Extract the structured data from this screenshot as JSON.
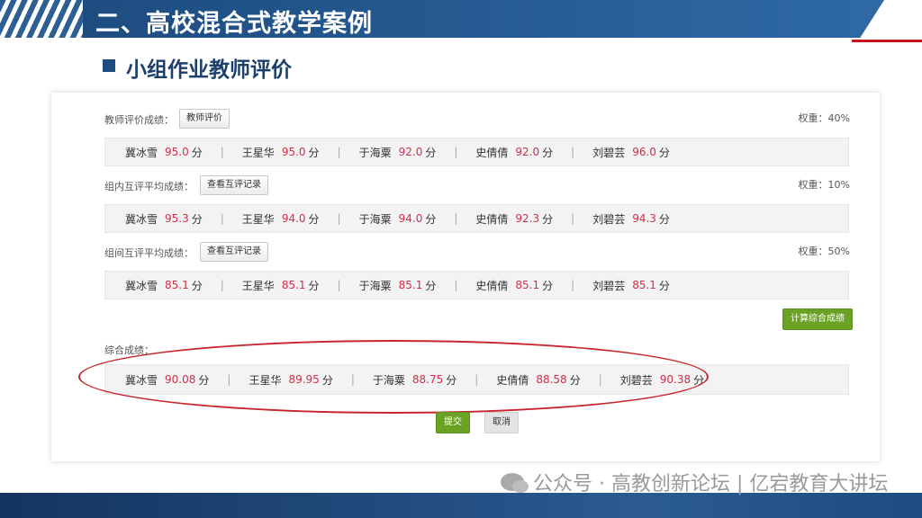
{
  "header": {
    "title": "二、高校混合式教学案例"
  },
  "subheader": {
    "title": "小组作业教师评价"
  },
  "sections": [
    {
      "label": "教师评价成绩：",
      "button": "教师评价",
      "weight": "权重：40%",
      "scores": [
        {
          "name": "冀冰雪",
          "value": "95.0",
          "unit": "分"
        },
        {
          "name": "王星华",
          "value": "95.0",
          "unit": "分"
        },
        {
          "name": "于海粟",
          "value": "92.0",
          "unit": "分"
        },
        {
          "name": "史倩倩",
          "value": "92.0",
          "unit": "分"
        },
        {
          "name": "刘碧芸",
          "value": "96.0",
          "unit": "分"
        }
      ]
    },
    {
      "label": "组内互评平均成绩：",
      "button": "查看互评记录",
      "weight": "权重：10%",
      "scores": [
        {
          "name": "冀冰雪",
          "value": "95.3",
          "unit": "分"
        },
        {
          "name": "王星华",
          "value": "94.0",
          "unit": "分"
        },
        {
          "name": "于海粟",
          "value": "94.0",
          "unit": "分"
        },
        {
          "name": "史倩倩",
          "value": "92.3",
          "unit": "分"
        },
        {
          "name": "刘碧芸",
          "value": "94.3",
          "unit": "分"
        }
      ]
    },
    {
      "label": "组间互评平均成绩：",
      "button": "查看互评记录",
      "weight": "权重：50%",
      "scores": [
        {
          "name": "冀冰雪",
          "value": "85.1",
          "unit": "分"
        },
        {
          "name": "王星华",
          "value": "85.1",
          "unit": "分"
        },
        {
          "name": "于海粟",
          "value": "85.1",
          "unit": "分"
        },
        {
          "name": "史倩倩",
          "value": "85.1",
          "unit": "分"
        },
        {
          "name": "刘碧芸",
          "value": "85.1",
          "unit": "分"
        }
      ]
    }
  ],
  "calc_button": "计算综合成绩",
  "total": {
    "label": "综合成绩：",
    "scores": [
      {
        "name": "冀冰雪",
        "value": "90.08",
        "unit": "分"
      },
      {
        "name": "王星华",
        "value": "89.95",
        "unit": "分"
      },
      {
        "name": "于海粟",
        "value": "88.75",
        "unit": "分"
      },
      {
        "name": "史倩倩",
        "value": "88.58",
        "unit": "分"
      },
      {
        "name": "刘碧芸",
        "value": "90.38",
        "unit": "分"
      }
    ]
  },
  "actions": {
    "submit": "提交",
    "cancel": "取消"
  },
  "watermark": "公众号 · 高教创新论坛 | 亿宕教育大讲坛",
  "colors": {
    "accent_red": "#d12f4a",
    "green": "#6aa324",
    "brand_blue": "#1d4c80"
  }
}
